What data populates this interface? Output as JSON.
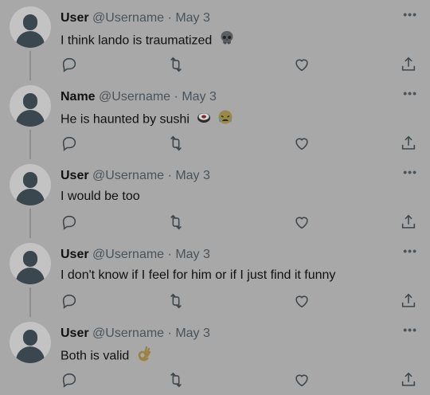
{
  "tweets": [
    {
      "name": "User",
      "handle": "@Username",
      "sep": "·",
      "date": "May 3",
      "text": "I think lando is traumatized",
      "emoji": [
        "skull-emoji"
      ]
    },
    {
      "name": "Name",
      "handle": "@Username",
      "sep": "·",
      "date": "May 3",
      "text": "He is haunted by sushi",
      "emoji": [
        "sushi-emoji",
        "crying-face-emoji"
      ]
    },
    {
      "name": "User",
      "handle": "@Username",
      "sep": "·",
      "date": "May 3",
      "text": "I would be too",
      "emoji": []
    },
    {
      "name": "User",
      "handle": "@Username",
      "sep": "·",
      "date": "May 3",
      "text": "I don't know if I feel for him or if I just find it funny",
      "emoji": []
    },
    {
      "name": "User",
      "handle": "@Username",
      "sep": "·",
      "date": "May 3",
      "text": "Both is valid",
      "emoji": [
        "ok-hand-emoji"
      ]
    }
  ],
  "more_label": "•••",
  "icons": {
    "reply": "reply-icon",
    "retweet": "retweet-icon",
    "like": "like-icon",
    "share": "share-icon"
  },
  "colors": {
    "background": "#a8a8a8",
    "text": "#111111",
    "muted": "#4a535a"
  }
}
